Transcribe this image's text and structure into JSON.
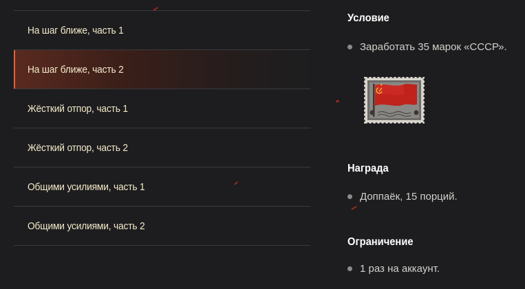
{
  "missions": [
    {
      "label": "На шаг ближе, часть 1",
      "active": false
    },
    {
      "label": "На шаг ближе, часть 2",
      "active": true
    },
    {
      "label": "Жёсткий отпор, часть 1",
      "active": false
    },
    {
      "label": "Жёсткий отпор, часть 2",
      "active": false
    },
    {
      "label": "Общими усилиями, часть 1",
      "active": false
    },
    {
      "label": "Общими усилиями, часть 2",
      "active": false
    }
  ],
  "details": {
    "condition": {
      "title": "Условие",
      "items": [
        "Заработать 35 марок «СССР»."
      ],
      "stamp_icon": "ussr-flag-stamp-icon"
    },
    "reward": {
      "title": "Награда",
      "items": [
        "Доппаёк, 15 порций."
      ]
    },
    "limit": {
      "title": "Ограничение",
      "items": [
        "1 раз на аккаунт."
      ]
    }
  },
  "colors": {
    "background": "#1d1d1f",
    "accent": "#e0603a",
    "divider": "#3a3a3c",
    "list_text": "#f2e8c8",
    "detail_text": "#d0d0cc"
  }
}
